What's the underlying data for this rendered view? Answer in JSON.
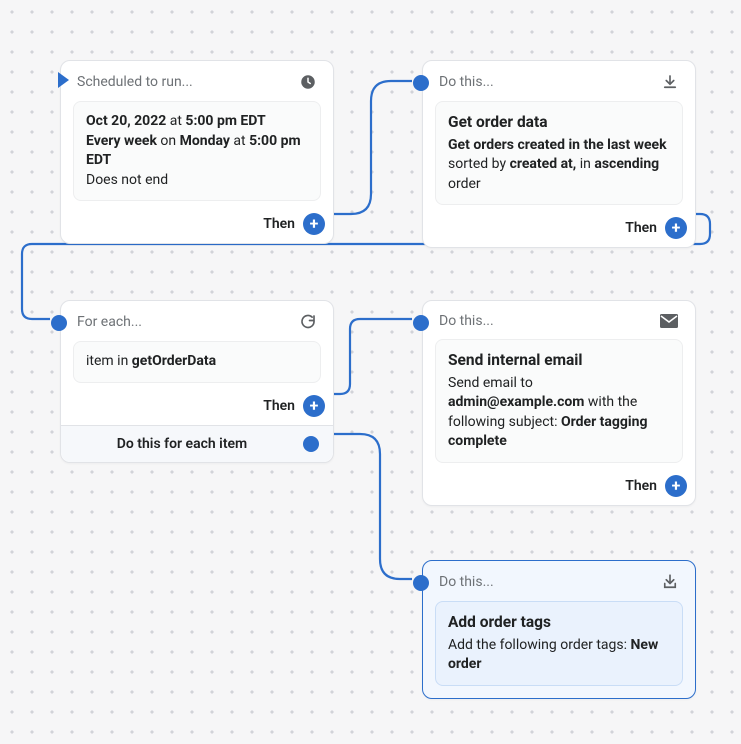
{
  "node1": {
    "head": "Scheduled to run...",
    "d1a": "Oct 20, 2022",
    "d1b": " at ",
    "d1c": "5:00 pm EDT",
    "d2a": "Every week",
    "d2b": " on ",
    "d2c": "Monday",
    "d2d": " at ",
    "d2e": "5:00 pm EDT",
    "d3": "Does not end",
    "then": "Then"
  },
  "node2": {
    "head": "Do this...",
    "title": "Get order data",
    "p1a": "Get orders created in the last week",
    "p1b": " sorted by ",
    "p1c": "created at,",
    "p1d": " in ",
    "p1e": "ascending",
    "p1f": " order",
    "then": "Then"
  },
  "node3": {
    "head": "For each...",
    "item_pre": "item in ",
    "item_b": "getOrderData",
    "then": "Then",
    "sub": "Do this for each item"
  },
  "node4": {
    "head": "Do this...",
    "title": "Send internal email",
    "p_a": "Send email to ",
    "p_b": "admin@example.com",
    "p_c": " with the following subject: ",
    "p_d": "Order tagging complete",
    "then": "Then"
  },
  "node5": {
    "head": "Do this...",
    "title": "Add order tags",
    "p_a": "Add the following order tags: ",
    "p_b": "New order"
  }
}
